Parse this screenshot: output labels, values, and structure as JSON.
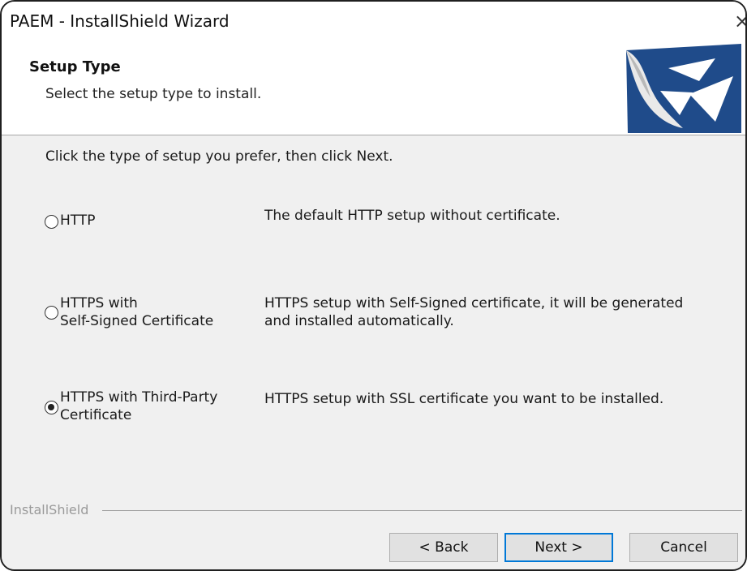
{
  "window": {
    "title": "PAEM - InstallShield Wizard",
    "close_glyph": "×"
  },
  "header": {
    "title": "Setup Type",
    "subtitle": "Select the setup type to install.",
    "logo_icon": "installshield-logo-icon"
  },
  "content": {
    "instruction": "Click the type of setup you prefer, then click Next.",
    "options": [
      {
        "label_lines": [
          "HTTP"
        ],
        "description_lines": [
          "The default HTTP setup without certificate."
        ],
        "selected": false
      },
      {
        "label_lines": [
          "HTTPS with",
          "Self-Signed Certificate"
        ],
        "description_lines": [
          "HTTPS setup with Self-Signed certificate, it will be generated",
          "and installed automatically."
        ],
        "selected": false
      },
      {
        "label_lines": [
          "HTTPS with Third-Party",
          "Certificate"
        ],
        "description_lines": [
          "HTTPS setup with SSL certificate you want to be installed."
        ],
        "selected": true
      }
    ]
  },
  "footer": {
    "brand": "InstallShield",
    "back_label": "< Back",
    "next_label": "Next >",
    "cancel_label": "Cancel"
  },
  "colors": {
    "accent": "#0078d7",
    "logo_blue": "#1f4b8a",
    "dialog_bg": "#f0f0f0"
  }
}
